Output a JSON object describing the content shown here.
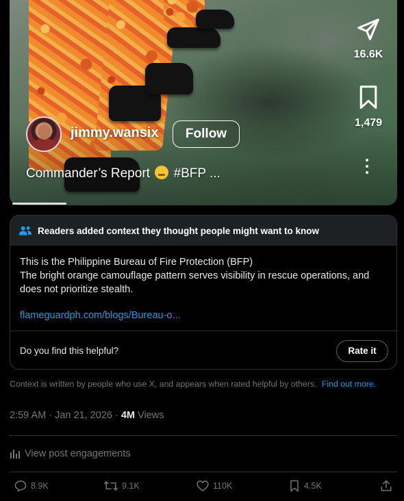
{
  "video": {
    "username": "jimmy.wansix",
    "follow_label": "Follow",
    "caption_before": "Commander’s Report",
    "caption_after": "#BFP ...",
    "share_count": "16.6K",
    "bookmark_count": "1,479",
    "progress_fraction": 0.14
  },
  "community_note": {
    "header": "Readers added context they thought people might want to know",
    "line1": "This is the Philippine Bureau of Fire Protection (BFP)",
    "line2": "The bright orange camouflage pattern serves visibility in rescue operations, and does not prioritize stealth.",
    "link": "flameguardph.com/blogs/Bureau-o...",
    "question": "Do you find this helpful?",
    "rate_label": "Rate it"
  },
  "disclaimer": {
    "text": "Context is written by people who use X, and appears when rated helpful by others.",
    "link": "Find out more."
  },
  "post_meta": {
    "time": "2:59 AM",
    "date": "Jan 21, 2026",
    "views_count": "4M",
    "views_label": "Views"
  },
  "engagements_label": "View post engagements",
  "actions": {
    "replies": "8.9K",
    "reposts": "9.1K",
    "likes": "110K",
    "bookmarks": "4.5K"
  },
  "colors": {
    "background": "#000000",
    "accent_link": "#1d9bf0",
    "muted": "#71767b",
    "border": "#2f3336",
    "note_header_bg": "#1e2124"
  }
}
